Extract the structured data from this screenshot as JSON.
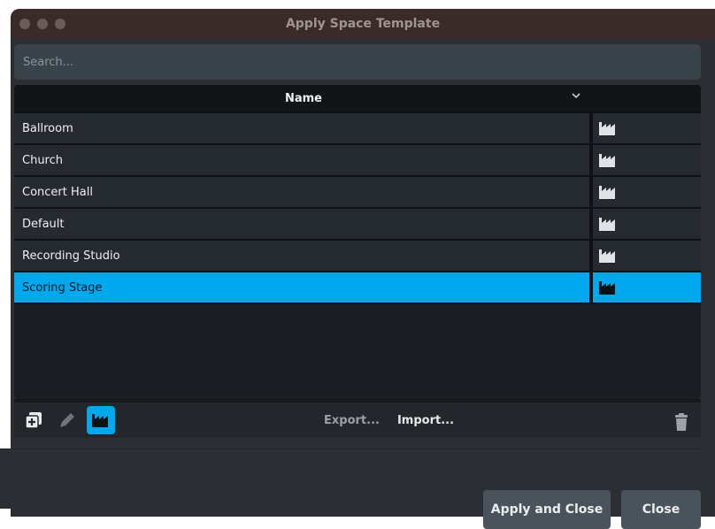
{
  "window": {
    "title": "Apply Space Template"
  },
  "search": {
    "placeholder": "Search..."
  },
  "table": {
    "header": "Name",
    "rows": [
      {
        "name": "Ballroom"
      },
      {
        "name": "Church"
      },
      {
        "name": "Concert Hall"
      },
      {
        "name": "Default"
      },
      {
        "name": "Recording Studio"
      },
      {
        "name": "Scoring Stage"
      }
    ],
    "selected_row": "Scoring Stage",
    "type_icon": "factory-icon"
  },
  "toolbar": {
    "export_label": "Export...",
    "import_label": "Import...",
    "icons": [
      "duplicate-add-icon",
      "pencil-icon",
      "factory-icon",
      "trash-icon"
    ]
  },
  "footer": {
    "apply_label": "Apply and Close",
    "close_label": "Close"
  },
  "colors": {
    "accent": "#00a9ee",
    "titlebar": "#3a2b28",
    "background": "#2b2e32"
  }
}
